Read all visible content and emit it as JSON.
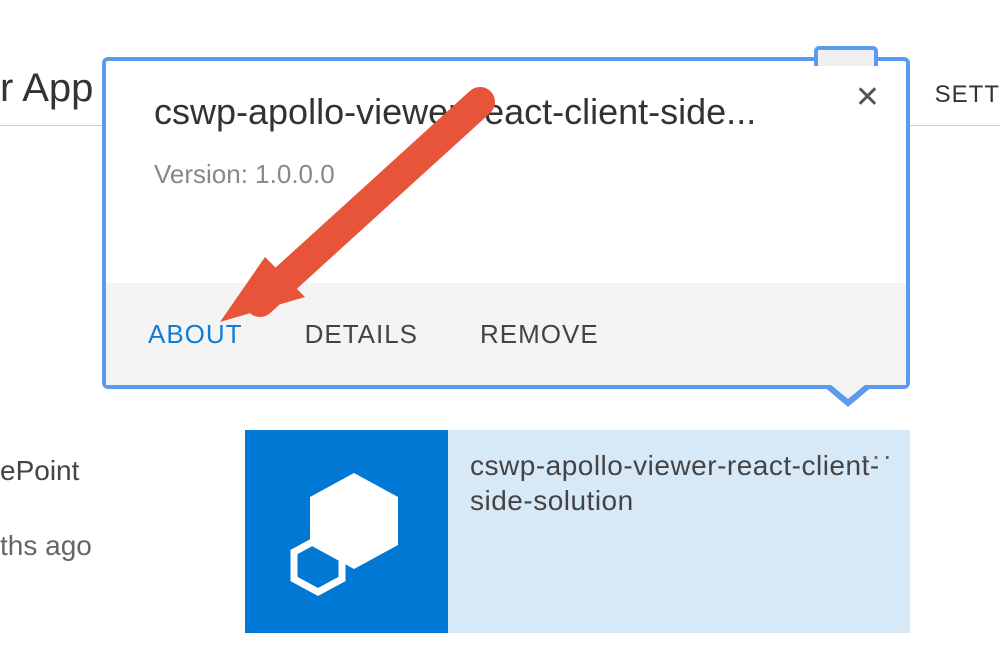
{
  "header": {
    "title_fragment": "r App",
    "settings_fragment": "SETT"
  },
  "left": {
    "frag1": "ePoint",
    "frag2": "ths ago"
  },
  "callout": {
    "title": "cswp-apollo-viewer-react-client-side...",
    "version_label": "Version: 1.0.0.0",
    "close_glyph": "✕",
    "actions": {
      "about": "ABOUT",
      "details": "DETAILS",
      "remove": "REMOVE"
    }
  },
  "tile": {
    "title": "cswp-apollo-viewer-react-client-side-solution",
    "more_glyph": "···",
    "icon_color": "#0078d4"
  }
}
